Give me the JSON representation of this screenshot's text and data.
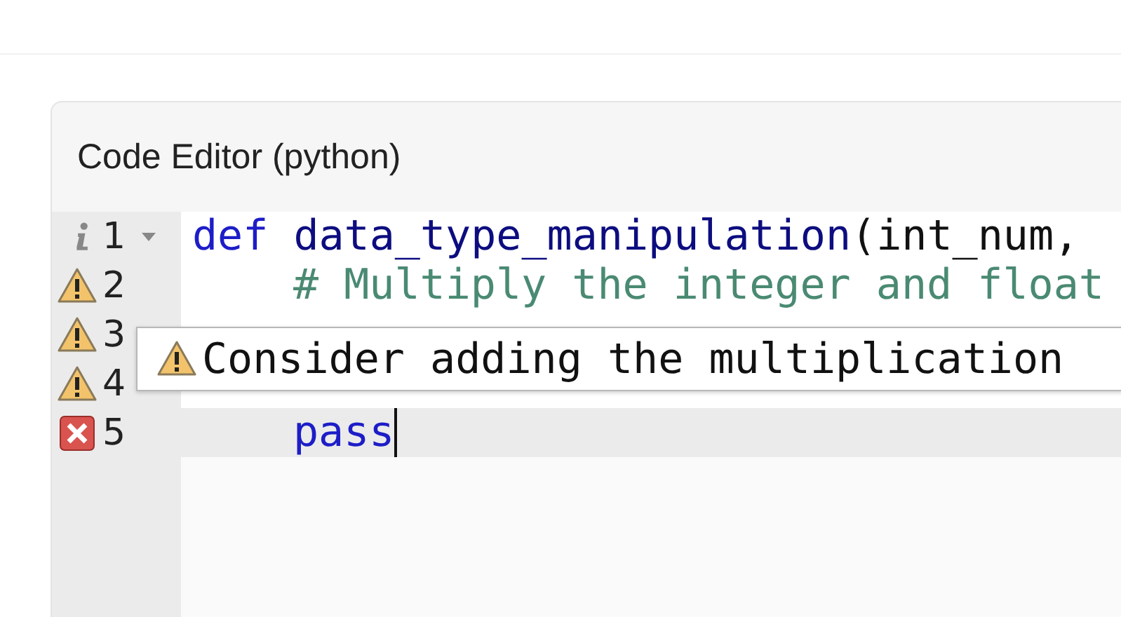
{
  "panel": {
    "title": "Code Editor (python)"
  },
  "lines": [
    {
      "number": "1",
      "kind": "info",
      "foldable": true,
      "active": false,
      "indented": false,
      "tokens": [
        {
          "kind": "keyword",
          "text": "def"
        },
        {
          "kind": "name",
          "text": "data_type_manipulation"
        },
        {
          "kind": "plain",
          "text": "(int_num,"
        }
      ]
    },
    {
      "number": "2",
      "kind": "warning",
      "active": false,
      "indented": true,
      "tokens": [
        {
          "kind": "comment",
          "text": "# Multiply the integer and float"
        }
      ]
    },
    {
      "number": "3",
      "kind": "warning",
      "active": false
    },
    {
      "number": "4",
      "kind": "warning",
      "active": false
    },
    {
      "number": "5",
      "kind": "error",
      "active": true,
      "indented": true,
      "tokens": [
        {
          "kind": "keyword",
          "text": "pass"
        }
      ]
    }
  ],
  "tooltip": {
    "kind": "warning",
    "text": "Consider adding the multiplication"
  }
}
